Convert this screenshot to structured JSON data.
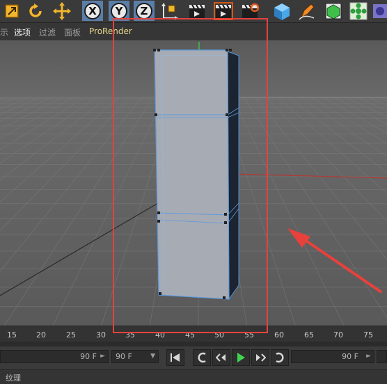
{
  "menu": {
    "items": [
      {
        "label": "示",
        "state": "normal"
      },
      {
        "label": "选项",
        "state": "active"
      },
      {
        "label": "过滤",
        "state": "normal"
      },
      {
        "label": "面板",
        "state": "normal"
      },
      {
        "label": "ProRender",
        "state": "plugin"
      }
    ]
  },
  "toolbar": {
    "axis_x": "X",
    "axis_y": "Y",
    "axis_z": "Z"
  },
  "timeline": {
    "ticks": [
      "15",
      "20",
      "25",
      "30",
      "35",
      "40",
      "45",
      "50",
      "55",
      "60",
      "65",
      "70",
      "75"
    ]
  },
  "transport": {
    "left_field_value": "90 F",
    "frame_field_value": "90 F",
    "right_field_value": "90 F"
  },
  "bottombar": {
    "label": "纹理"
  },
  "colors": {
    "annotation": "#e8413c",
    "selection": "#5a7ea8"
  }
}
